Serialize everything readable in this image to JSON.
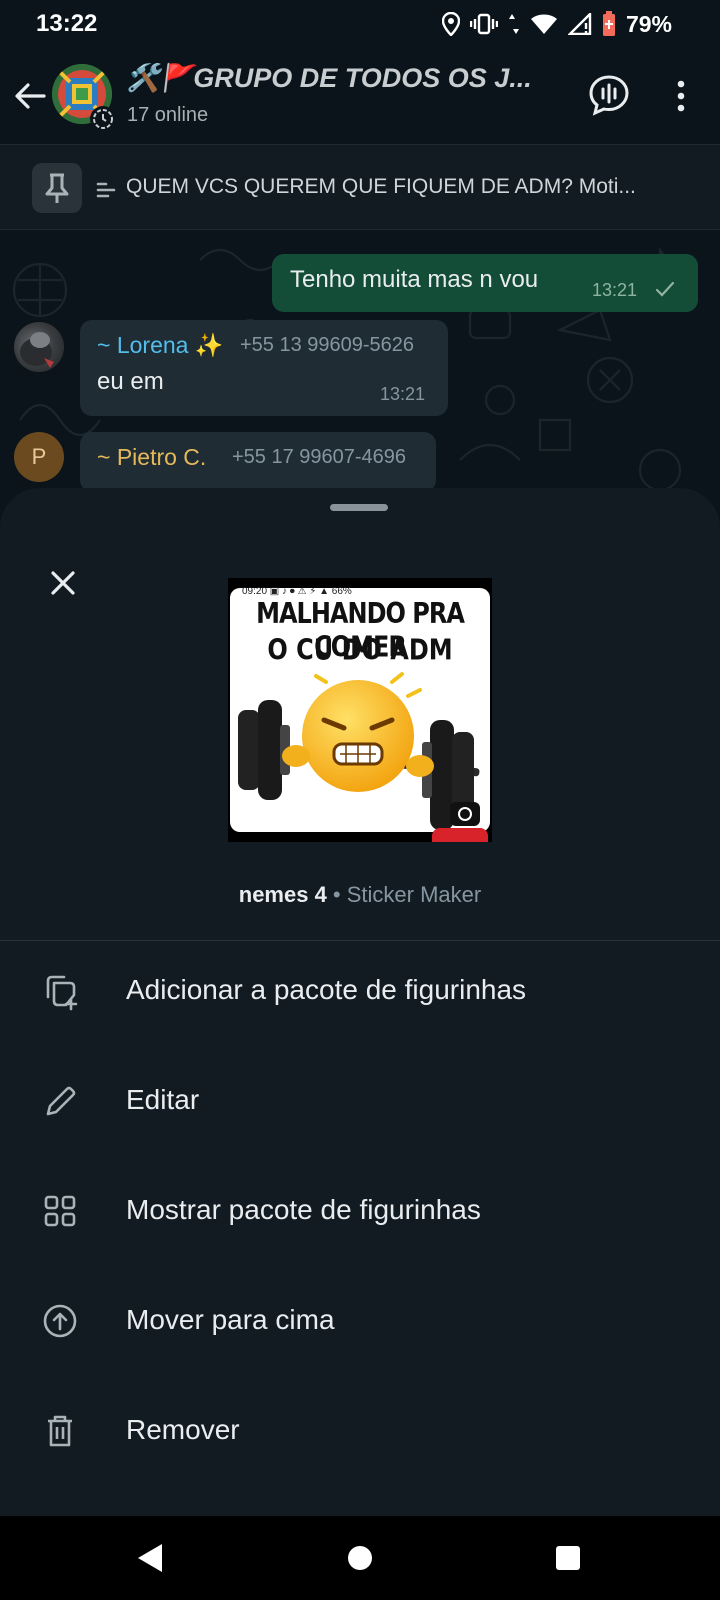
{
  "status_bar": {
    "time": "13:22",
    "battery": "79%",
    "icons": [
      "location-icon",
      "vibrate-icon",
      "data-arrows-icon",
      "wifi-icon",
      "cell-signal-icon",
      "battery-icon"
    ]
  },
  "header": {
    "title": "🛠️🚩GRUPO DE TODOS OS J...",
    "subtitle": "17 online",
    "icons": [
      "back-arrow-icon",
      "group-avatar",
      "voice-chat-icon",
      "more-vert-icon"
    ]
  },
  "pinned": {
    "text": "QUEM VCS QUEREM QUE FIQUEM DE ADM? Moti..."
  },
  "messages": {
    "outgoing": {
      "text": "Tenho muita mas n vou",
      "time": "13:21"
    },
    "lorena": {
      "sender": "~ Lorena ✨",
      "phone": "+55 13 99609-5626",
      "text": "eu em",
      "time": "13:21"
    },
    "pietro": {
      "initial": "P",
      "sender": "~ Pietro C.",
      "phone": "+55 17 99607-4696"
    }
  },
  "sticker": {
    "status_text": "09:20 ▣ ♪ ⏺  ⚠ ⚡ ▲ 66%",
    "caption_line1": "MALHANDO PRA COMER",
    "caption_line2": "O CU DO ADM",
    "pack_name": "nemes 4",
    "separator": " • ",
    "pack_app": "Sticker Maker"
  },
  "menu": [
    {
      "label": "Adicionar a pacote de figurinhas",
      "icon": "add-sticker-icon"
    },
    {
      "label": "Editar",
      "icon": "pencil-icon"
    },
    {
      "label": "Mostrar pacote de figurinhas",
      "icon": "grid-icon"
    },
    {
      "label": "Mover para cima",
      "icon": "arrow-up-circle-icon"
    },
    {
      "label": "Remover",
      "icon": "trash-icon"
    }
  ],
  "colors": {
    "background": "#0b141a",
    "sheet": "#121b22",
    "outgoing_bubble": "#144d37",
    "incoming_bubble": "#1f2c34",
    "lorena_name": "#53bdeb",
    "pietro_name": "#e5b95a"
  }
}
